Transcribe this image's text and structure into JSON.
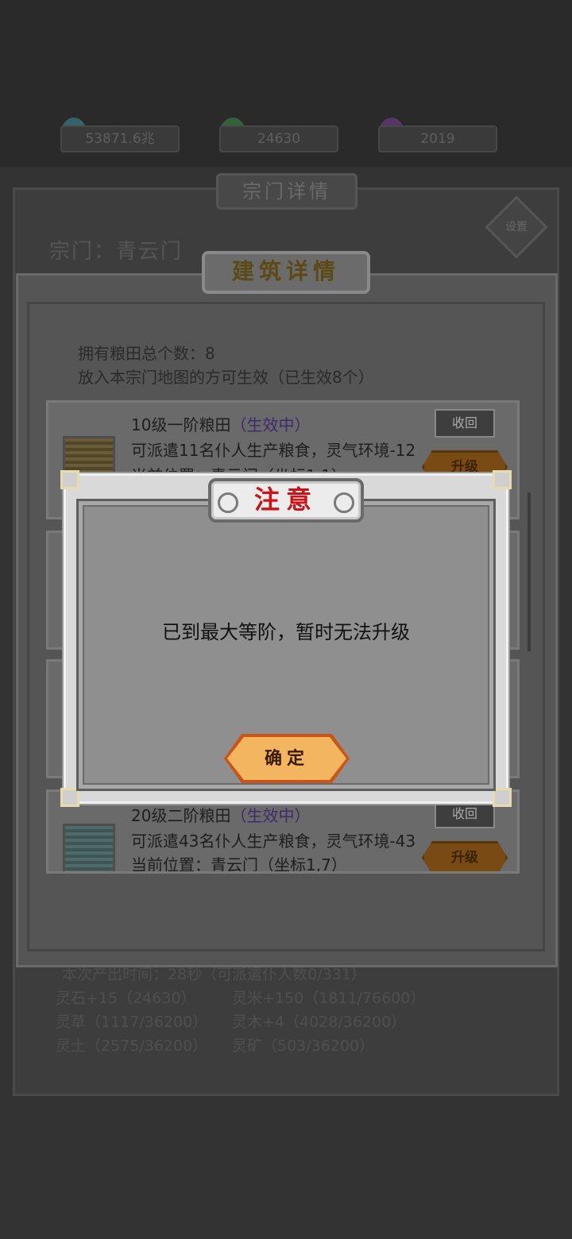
{
  "resources": [
    {
      "value": "53871.6兆",
      "icon": "spirit-stone-icon",
      "color": "#3f8f9a"
    },
    {
      "value": "24630",
      "icon": "spirit-grass-icon",
      "color": "#3f8a4a"
    },
    {
      "value": "2019",
      "icon": "spirit-crystal-icon",
      "color": "#7a3f8f"
    }
  ],
  "sect_panel": {
    "title": "宗门详情",
    "name": "宗门：青云门",
    "badge": "设置"
  },
  "bg_stats": [
    "本次产出时间：28秒（可派遣仆人数0/331）",
    [
      "灵石+15（24630）",
      "灵米+150（1811/76600）"
    ],
    [
      "灵草（1117/36200）",
      "灵木+4（4028/36200）"
    ],
    [
      "灵土（2575/36200）",
      "灵矿（503/36200）"
    ]
  ],
  "building_panel": {
    "title": "建筑详情",
    "summary_count": "拥有粮田总个数：8",
    "summary_effect": "放入本宗门地图的方可生效（已生效8个）",
    "cards": [
      {
        "name": "10级一阶粮田",
        "status": "（生效中）",
        "desc": "可派遣11名仆人生产粮食，灵气环境-12",
        "location": "当前位置：青云门（坐标1,1）",
        "recall_label": "收回",
        "upgrade_label": "升级"
      },
      {
        "name": "20级二阶粮田",
        "status": "（生效中）",
        "desc": "可派遣43名仆人生产粮食，灵气环境-43",
        "location": "当前位置：青云门（坐标1,7）",
        "recall_label": "收回",
        "upgrade_label": "升级"
      }
    ]
  },
  "modal": {
    "title": "注意",
    "message": "已到最大等阶，暂时无法升级",
    "confirm_label": "确定"
  },
  "colors": {
    "modal_title": "#c8141a",
    "confirm_button": "#f3b560",
    "status_text": "#3f2a6a"
  }
}
